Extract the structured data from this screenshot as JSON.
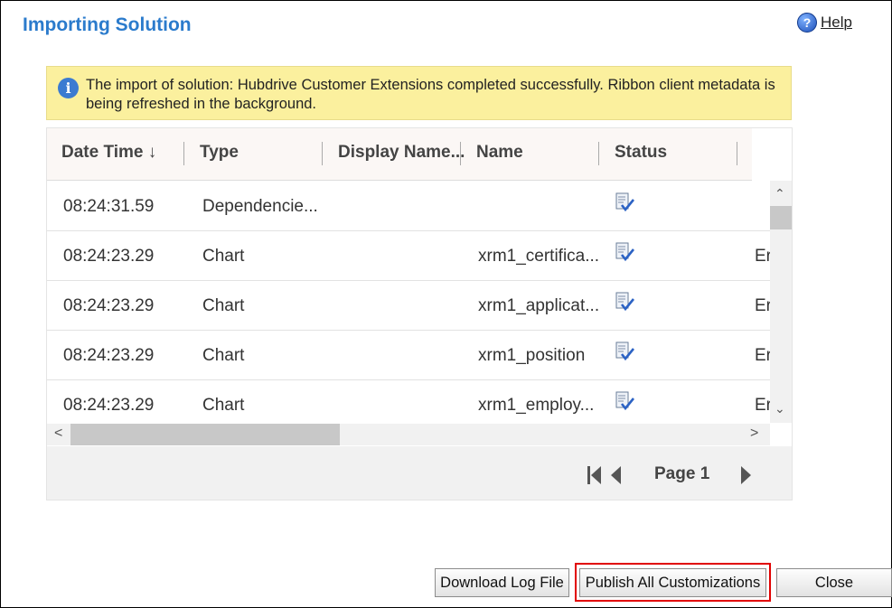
{
  "dialog": {
    "title": "Importing Solution",
    "help_label": "Help",
    "help_icon": "question-help-icon"
  },
  "banner": {
    "icon": "info-icon",
    "message": "The import of solution: Hubdrive Customer Extensions completed successfully. Ribbon client metadata is being refreshed in the background."
  },
  "grid": {
    "columns": [
      "Date Time",
      "Type",
      "Display Name...",
      "Name",
      "Status"
    ],
    "sort_indicator": "↓",
    "rows": [
      {
        "datetime": "08:24:31.59",
        "type": "Dependencie...",
        "display_name": "",
        "name": "",
        "status_icon": "completed-check-icon",
        "extra": ""
      },
      {
        "datetime": "08:24:23.29",
        "type": "Chart",
        "display_name": "",
        "name": "xrm1_certifica...",
        "status_icon": "completed-check-icon",
        "extra": "Er"
      },
      {
        "datetime": "08:24:23.29",
        "type": "Chart",
        "display_name": "",
        "name": "xrm1_applicat...",
        "status_icon": "completed-check-icon",
        "extra": "Er"
      },
      {
        "datetime": "08:24:23.29",
        "type": "Chart",
        "display_name": "",
        "name": "xrm1_position",
        "status_icon": "completed-check-icon",
        "extra": "Er"
      },
      {
        "datetime": "08:24:23.29",
        "type": "Chart",
        "display_name": "",
        "name": "xrm1_employ...",
        "status_icon": "completed-check-icon",
        "extra": "Er"
      }
    ]
  },
  "pager": {
    "label": "Page 1"
  },
  "buttons": {
    "download": "Download Log File",
    "publish": "Publish All Customizations",
    "close": "Close"
  },
  "colors": {
    "title": "#2b7bcc",
    "banner_bg": "#fbf09e",
    "highlight": "#e10000"
  }
}
